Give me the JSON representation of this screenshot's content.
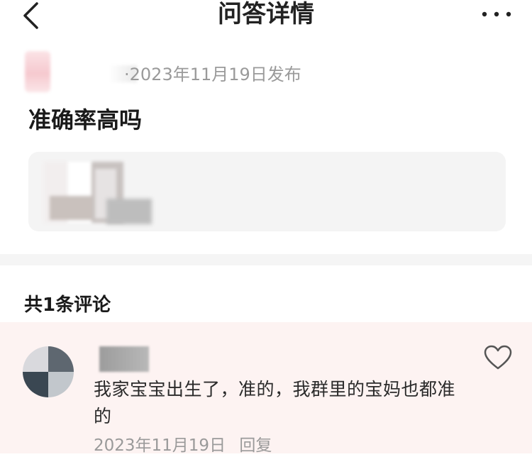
{
  "header": {
    "title": "问答详情",
    "back_icon": "chevron-left-icon",
    "more_icon": "more-horizontal-icon"
  },
  "question": {
    "publish_info": "·2023年11月19日发布",
    "title": "准确率高吗"
  },
  "comments": {
    "heading": "共1条评论",
    "items": [
      {
        "text": "我家宝宝出生了，准的，我群里的宝妈也都准的",
        "date": "2023年11月19日",
        "reply_label": "回复",
        "like_icon": "heart-outline-icon"
      }
    ]
  },
  "colors": {
    "background": "#ffffff",
    "divider": "#f5f5f5",
    "card": "#f4f4f4",
    "comment_bg": "#fdf3f2",
    "muted_text": "#9a9a9a",
    "primary_text": "#1a1a1a"
  }
}
